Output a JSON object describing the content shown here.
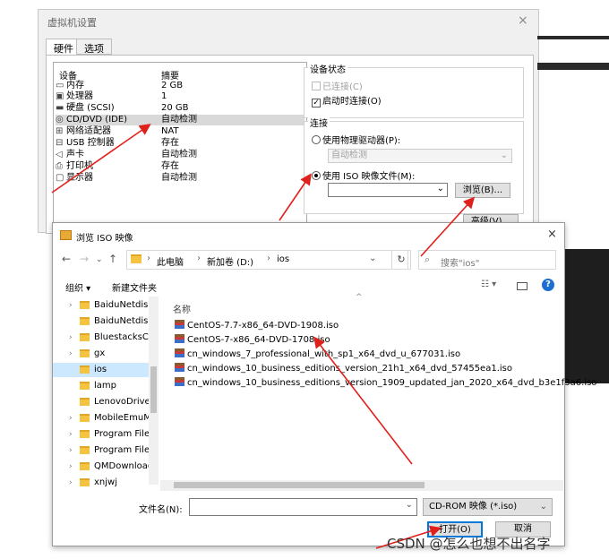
{
  "vm_dialog": {
    "title": "虚拟机设置",
    "close_icon": "×",
    "tabs": [
      "硬件",
      "选项"
    ],
    "hw_columns": {
      "device": "设备",
      "summary": "摘要"
    },
    "hw_rows": [
      {
        "icon": "memory-icon",
        "glyph": "▭",
        "device": "内存",
        "summary": "2 GB"
      },
      {
        "icon": "cpu-icon",
        "glyph": "▣",
        "device": "处理器",
        "summary": "1"
      },
      {
        "icon": "disk-icon",
        "glyph": "▬",
        "device": "硬盘 (SCSI)",
        "summary": "20 GB"
      },
      {
        "icon": "cdrom-icon",
        "glyph": "◎",
        "device": "CD/DVD (IDE)",
        "summary": "自动检测"
      },
      {
        "icon": "network-icon",
        "glyph": "⊞",
        "device": "网络适配器",
        "summary": "NAT"
      },
      {
        "icon": "usb-icon",
        "glyph": "⊟",
        "device": "USB 控制器",
        "summary": "存在"
      },
      {
        "icon": "sound-icon",
        "glyph": "◁",
        "device": "声卡",
        "summary": "自动检测"
      },
      {
        "icon": "printer-icon",
        "glyph": "⎙",
        "device": "打印机",
        "summary": "存在"
      },
      {
        "icon": "display-icon",
        "glyph": "▢",
        "device": "显示器",
        "summary": "自动检测"
      }
    ],
    "device_status": {
      "title": "设备状态",
      "connected": "已连接(C)",
      "connect_at_power_on": "启动时连接(O)"
    },
    "connection": {
      "title": "连接",
      "use_physical": "使用物理驱动器(P):",
      "physical_value": "自动检测",
      "use_iso": "使用 ISO 映像文件(M):",
      "browse": "浏览(B)...",
      "advanced": "高级(V)..."
    }
  },
  "iso_dialog": {
    "title": "浏览 ISO 映像",
    "close_icon": "×",
    "breadcrumb": [
      "此电脑",
      "新加卷 (D:)",
      "ios"
    ],
    "search_placeholder": "搜索\"ios\"",
    "toolbar": {
      "organize": "组织 ▾",
      "new_folder": "新建文件夹"
    },
    "column_name": "名称",
    "nav_items": [
      "BaiduNetdisk",
      "BaiduNetdisk",
      "BluestacksCN",
      "gx",
      "ios",
      "lamp",
      "LenovoDriver",
      "MobileEmuM",
      "Program Files",
      "Program Files",
      "QMDownload",
      "xnjwj"
    ],
    "nav_selected": "ios",
    "files": [
      "CentOS-7.7-x86_64-DVD-1908.iso",
      "CentOS-7-x86_64-DVD-1708.iso",
      "cn_windows_7_professional_with_sp1_x64_dvd_u_677031.iso",
      "cn_windows_10_business_editions_version_21h1_x64_dvd_57455ea1.iso",
      "cn_windows_10_business_editions_version_1909_updated_jan_2020_x64_dvd_b3e1f3a6.iso"
    ],
    "filename_label": "文件名(N):",
    "filename_value": "",
    "filter_value": "CD-ROM 映像 (*.iso)",
    "open": "打开(O)",
    "cancel": "取消"
  },
  "watermark": "CSDN @怎么也想不出名字",
  "colors": {
    "annotation": "#e0201b",
    "selection": "#cce8ff",
    "folder": "#f5c342"
  }
}
